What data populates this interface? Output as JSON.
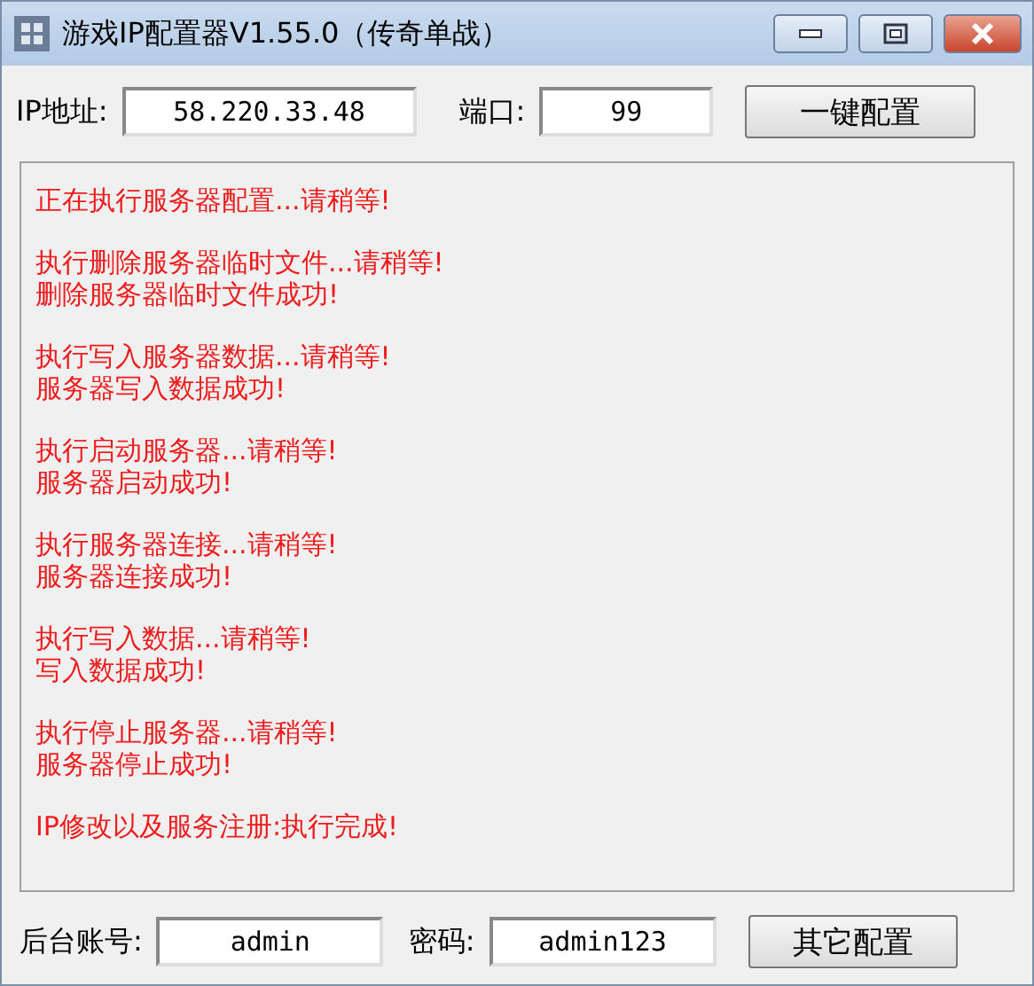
{
  "window": {
    "title": "游戏IP配置器V1.55.0（传奇单战）"
  },
  "ip": {
    "label": "IP地址:",
    "value": "58.220.33.48"
  },
  "port": {
    "label": "端口:",
    "value": "99"
  },
  "config_button": "一键配置",
  "log": [
    {
      "lines": [
        "正在执行服务器配置...请稍等!"
      ]
    },
    {
      "lines": [
        "执行删除服务器临时文件...请稍等!",
        "删除服务器临时文件成功!"
      ]
    },
    {
      "lines": [
        "执行写入服务器数据...请稍等!",
        "服务器写入数据成功!"
      ]
    },
    {
      "lines": [
        "执行启动服务器...请稍等!",
        "服务器启动成功!"
      ]
    },
    {
      "lines": [
        "执行服务器连接...请稍等!",
        "服务器连接成功!"
      ]
    },
    {
      "lines": [
        "执行写入数据...请稍等!",
        "写入数据成功!"
      ]
    },
    {
      "lines": [
        "执行停止服务器...请稍等!",
        "服务器停止成功!"
      ]
    },
    {
      "lines": [
        "IP修改以及服务注册:执行完成!"
      ]
    }
  ],
  "account": {
    "label": "后台账号:",
    "value": "admin"
  },
  "password": {
    "label": "密码:",
    "value": "admin123"
  },
  "other_button": "其它配置"
}
